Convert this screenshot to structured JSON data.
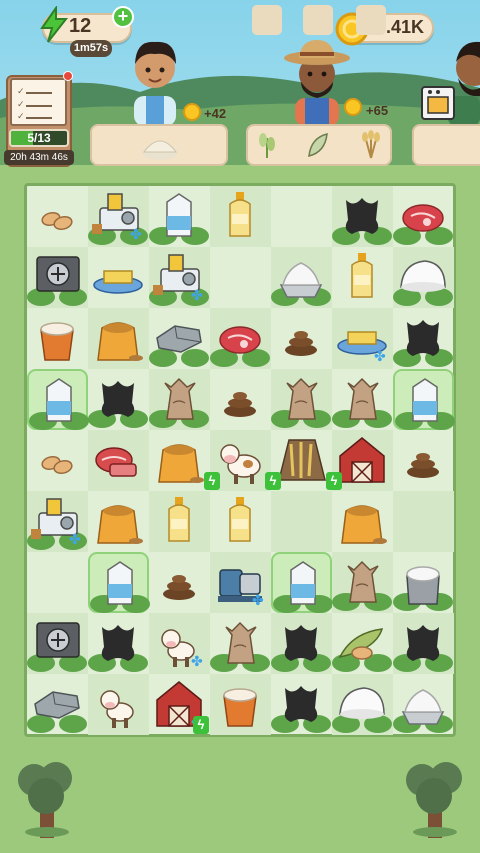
{
  "hud": {
    "energy": {
      "value": "12",
      "timer": "1m57s",
      "plus_label": "+"
    },
    "coins": {
      "value": "5.41K"
    }
  },
  "quests": {
    "progress_text": "5/13",
    "progress_fraction": 0.385,
    "timer": "20h 43m 46s"
  },
  "customers": [
    {
      "name": "customer-1",
      "reward": "+42",
      "wants": [
        "flour-icon"
      ]
    },
    {
      "name": "customer-2",
      "reward": "+65",
      "wants": [
        "wheat-sprout-icon",
        "leaf-icon",
        "wheat-bundle-icon"
      ]
    },
    {
      "name": "customer-3",
      "reward": "",
      "wants": [
        "oven-icon"
      ]
    }
  ],
  "board": {
    "columns": 7,
    "rows": 9,
    "cells": [
      [
        "almonds-icon",
        "grinder-machine-icon",
        "milk-carton-icon",
        "oil-bottle-icon",
        "empty",
        "leather-icon",
        "steak-icon"
      ],
      [
        "oven-machine-icon",
        "butter-dish-icon",
        "grinder-machine-icon",
        "empty",
        "whipped-cream-icon",
        "oil-bottle-icon",
        "cheese-icon"
      ],
      [
        "flour-pot-icon",
        "flour-sack-icon",
        "stone-slab-icon",
        "steak-icon",
        "dung-icon",
        "butter-dish-icon",
        "leather-icon"
      ],
      [
        "milk-carton-icon",
        "leather-icon",
        "grain-sack-icon",
        "dung-icon",
        "grain-sack-icon",
        "grain-sack-icon",
        "milk-carton-icon"
      ],
      [
        "almonds-icon",
        "sliced-meat-icon",
        "flour-sack-icon",
        "cow-icon",
        "wheat-field-icon",
        "barn-icon",
        "dung-icon"
      ],
      [
        "grinder-machine-icon",
        "flour-sack-icon",
        "oil-bottle-icon",
        "oil-bottle-icon",
        "empty",
        "flour-sack-icon",
        "empty"
      ],
      [
        "empty",
        "milk-carton-icon",
        "dung-icon",
        "mixer-machine-icon",
        "milk-carton-icon",
        "grain-sack-icon",
        "cream-pot-icon"
      ],
      [
        "oven-machine-icon",
        "leather-icon",
        "calf-icon",
        "grain-sack-icon",
        "leather-icon",
        "almond-leaf-icon",
        "leather-icon"
      ],
      [
        "stone-slab-icon",
        "calf-icon",
        "barn-icon",
        "flour-pot-icon",
        "leather-icon",
        "cheese-icon",
        "whipped-cream-icon"
      ]
    ],
    "highlighted": [
      "3-0",
      "3-6",
      "6-1",
      "6-4"
    ]
  },
  "colors": {
    "grass": "#9cc97c",
    "board": "#e1efd7",
    "energy": "#52c13f",
    "coin": "#f9c623"
  }
}
